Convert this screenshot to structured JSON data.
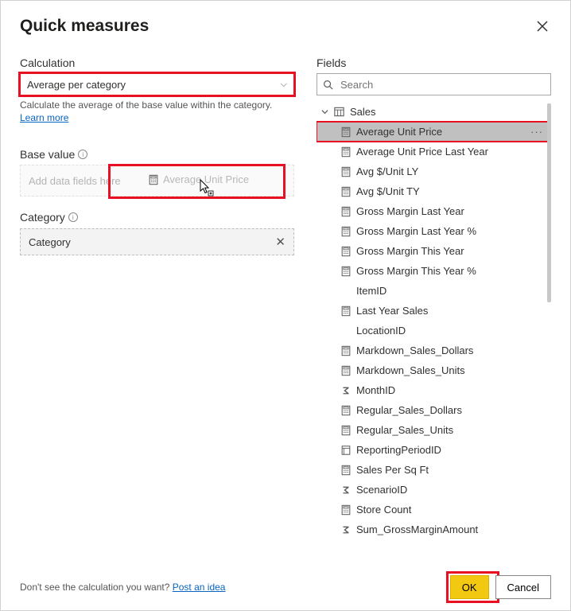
{
  "title": "Quick measures",
  "left": {
    "calculation_label": "Calculation",
    "calculation_value": "Average per category",
    "description": "Calculate the average of the base value within the category.",
    "learn_more": "Learn more",
    "base_value_label": "Base value",
    "dropzone_placeholder": "Add data fields here",
    "drag_ghost": "Average Unit Price",
    "category_label": "Category",
    "category_value": "Category"
  },
  "right": {
    "fields_label": "Fields",
    "search_placeholder": "Search",
    "table_name": "Sales",
    "selected_field": "Average Unit Price",
    "fields": [
      {
        "label": "Average Unit Price",
        "icon": "calc",
        "selected": true
      },
      {
        "label": "Average Unit Price Last Year",
        "icon": "calc"
      },
      {
        "label": "Avg $/Unit LY",
        "icon": "calc"
      },
      {
        "label": "Avg $/Unit TY",
        "icon": "calc"
      },
      {
        "label": "Gross Margin Last Year",
        "icon": "calc"
      },
      {
        "label": "Gross Margin Last Year %",
        "icon": "calc"
      },
      {
        "label": "Gross Margin This Year",
        "icon": "calc"
      },
      {
        "label": "Gross Margin This Year %",
        "icon": "calc"
      },
      {
        "label": "ItemID",
        "icon": "none"
      },
      {
        "label": "Last Year Sales",
        "icon": "calc"
      },
      {
        "label": "LocationID",
        "icon": "none"
      },
      {
        "label": "Markdown_Sales_Dollars",
        "icon": "calc"
      },
      {
        "label": "Markdown_Sales_Units",
        "icon": "calc"
      },
      {
        "label": "MonthID",
        "icon": "sigma"
      },
      {
        "label": "Regular_Sales_Dollars",
        "icon": "calc"
      },
      {
        "label": "Regular_Sales_Units",
        "icon": "calc"
      },
      {
        "label": "ReportingPeriodID",
        "icon": "hier"
      },
      {
        "label": "Sales Per Sq Ft",
        "icon": "calc"
      },
      {
        "label": "ScenarioID",
        "icon": "sigma"
      },
      {
        "label": "Store Count",
        "icon": "calc"
      },
      {
        "label": "Sum_GrossMarginAmount",
        "icon": "sigma"
      }
    ]
  },
  "footer": {
    "prompt": "Don't see the calculation you want? ",
    "post_idea": "Post an idea",
    "ok": "OK",
    "cancel": "Cancel"
  }
}
